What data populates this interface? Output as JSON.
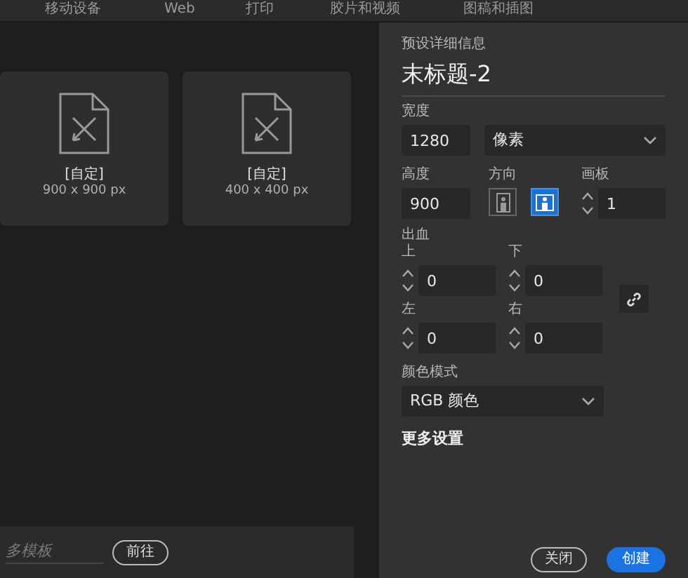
{
  "tabs": [
    {
      "label": "移动设备",
      "selected": false
    },
    {
      "label": "Web",
      "selected": false
    },
    {
      "label": "打印",
      "selected": false
    },
    {
      "label": "胶片和视频",
      "selected": false
    },
    {
      "label": "图稿和插图",
      "selected": false
    }
  ],
  "presets": [
    {
      "name": "[自定]",
      "size": "900 x 900 px"
    },
    {
      "name": "[自定]",
      "size": "400 x 400 px"
    }
  ],
  "template_search": {
    "placeholder": "多模板"
  },
  "go_button": "前往",
  "details": {
    "heading": "预设详细信息",
    "doc_name": "末标题-2",
    "width": {
      "label": "宽度",
      "value": "1280"
    },
    "unit": {
      "value": "像素"
    },
    "height": {
      "label": "高度",
      "value": "900"
    },
    "orientation": {
      "label": "方向",
      "options": [
        {
          "kind": "portrait",
          "selected": false
        },
        {
          "kind": "landscape",
          "selected": true
        }
      ]
    },
    "artboards": {
      "label": "画板",
      "value": "1"
    },
    "bleed": {
      "label": "出血",
      "fields": [
        {
          "label": "上",
          "value": "0"
        },
        {
          "label": "下",
          "value": "0"
        },
        {
          "label": "左",
          "value": "0"
        },
        {
          "label": "右",
          "value": "0"
        }
      ]
    },
    "color_mode": {
      "label": "颜色模式",
      "value": "RGB 颜色"
    },
    "more_settings": "更多设置"
  },
  "buttons": [
    {
      "label": "关闭",
      "kind": "secondary"
    },
    {
      "label": "创建",
      "kind": "primary"
    }
  ]
}
